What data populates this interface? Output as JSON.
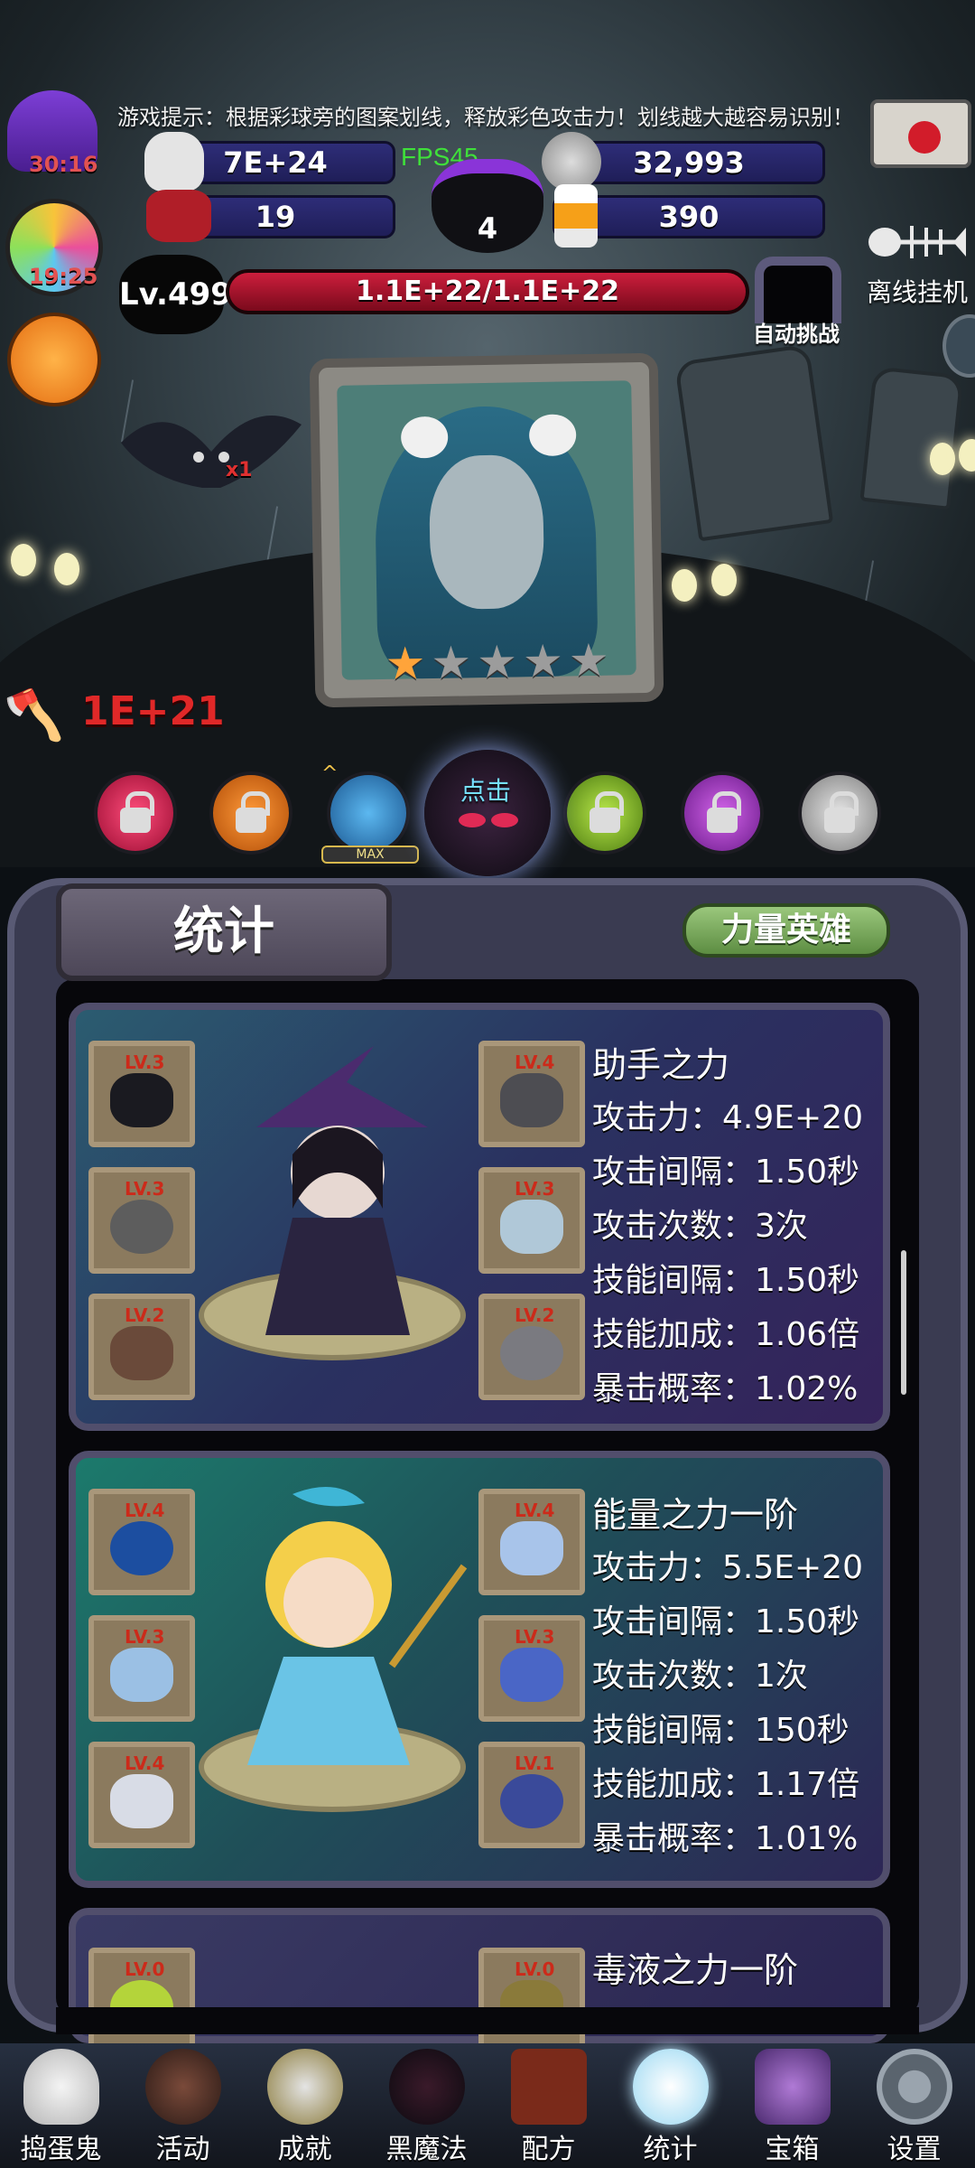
{
  "tip": "游戏提示：根据彩球旁的图案划线，释放彩色攻击力！划线越大越容易识别！",
  "fps": "FPS45",
  "resources": {
    "gold": "7E+24",
    "skull_score": "32,993",
    "bombs": "19",
    "candy": "390",
    "cauldron": "4"
  },
  "timers": {
    "hat_timer": "30:16",
    "candy_timer": "19:25"
  },
  "level": "Lv.499",
  "hp": "1.1E+22/1.1E+22",
  "auto_challenge": "自动挑战",
  "offline_idle": "离线挂机",
  "bat_multiplier": "x1",
  "enemy_stars": {
    "filled": 1,
    "total": 5
  },
  "attack_power": "1E+21",
  "orbs": {
    "max_label": "MAX",
    "click_label": "点击"
  },
  "panel": {
    "title": "统计",
    "hero_button": "力量英雄"
  },
  "heroes": [
    {
      "name": "助手之力",
      "stats": [
        "攻击力：4.9E+20",
        "攻击间隔：1.50秒",
        "攻击次数：3次",
        "技能间隔：1.50秒",
        "技能加成：1.06倍",
        "暴击概率：1.02%"
      ],
      "slot_levels": [
        "LV.3",
        "LV.3",
        "LV.2",
        "LV.4",
        "LV.3",
        "LV.2"
      ]
    },
    {
      "name": "能量之力一阶",
      "stats": [
        "攻击力：5.5E+20",
        "攻击间隔：1.50秒",
        "攻击次数：1次",
        "技能间隔：150秒",
        "技能加成：1.17倍",
        "暴击概率：1.01%"
      ],
      "slot_levels": [
        "LV.4",
        "LV.3",
        "LV.4",
        "LV.4",
        "LV.3",
        "LV.1"
      ]
    },
    {
      "name": "毒液之力一阶",
      "stats": [],
      "slot_levels": [
        "LV.0",
        "LV.0"
      ]
    }
  ],
  "nav": [
    "捣蛋鬼",
    "活动",
    "成就",
    "黑魔法",
    "配方",
    "统计",
    "宝箱",
    "设置"
  ]
}
